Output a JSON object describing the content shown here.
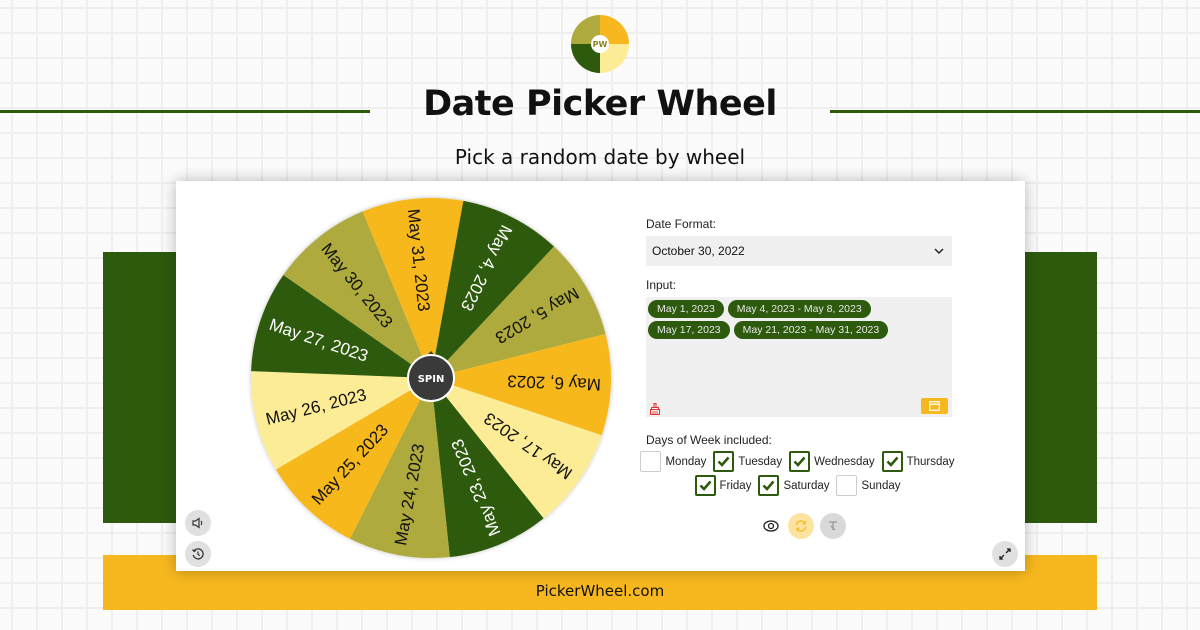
{
  "header": {
    "logo_text": "PW",
    "title": "Date Picker Wheel",
    "subtitle": "Pick a random date by wheel"
  },
  "colors": {
    "dark_green": "#2d5a0d",
    "olive": "#aeaa3e",
    "gold": "#f7b81f",
    "light_yellow": "#fdec96",
    "spin_button": "#3a3a3a",
    "clear_icon": "#e03030"
  },
  "wheel": {
    "spin_label": "SPIN",
    "slices": [
      {
        "label": "May 31, 2023",
        "color": "#f7b81f",
        "text_color": "#111111"
      },
      {
        "label": "May 4, 2023",
        "color": "#2d5a0d",
        "text_color": "#ffffff"
      },
      {
        "label": "May 5, 2023",
        "color": "#aeaa3e",
        "text_color": "#111111"
      },
      {
        "label": "May 6, 2023",
        "color": "#f7b81f",
        "text_color": "#111111"
      },
      {
        "label": "May 17, 2023",
        "color": "#fdec96",
        "text_color": "#111111"
      },
      {
        "label": "May 23, 2023",
        "color": "#2d5a0d",
        "text_color": "#ffffff"
      },
      {
        "label": "May 24, 2023",
        "color": "#aeaa3e",
        "text_color": "#111111"
      },
      {
        "label": "May 25, 2023",
        "color": "#f7b81f",
        "text_color": "#111111"
      },
      {
        "label": "May 26, 2023",
        "color": "#fdec96",
        "text_color": "#111111"
      },
      {
        "label": "May 27, 2023",
        "color": "#2d5a0d",
        "text_color": "#ffffff"
      },
      {
        "label": "May 30, 2023",
        "color": "#aeaa3e",
        "text_color": "#111111"
      }
    ]
  },
  "controls": {
    "sound_icon": "speaker-icon",
    "history_icon": "history-icon",
    "fullscreen_icon": "expand-icon"
  },
  "panel": {
    "date_format_label": "Date Format:",
    "date_format_value": "October 30, 2022",
    "input_label": "Input:",
    "chips": [
      "May 1, 2023",
      "May 4, 2023 - May 8, 2023",
      "May 17, 2023",
      "May 21, 2023 - May 31, 2023"
    ],
    "days_label": "Days of Week included:",
    "days": [
      {
        "name": "Monday",
        "checked": false
      },
      {
        "name": "Tuesday",
        "checked": true
      },
      {
        "name": "Wednesday",
        "checked": true
      },
      {
        "name": "Thursday",
        "checked": true
      },
      {
        "name": "Friday",
        "checked": true
      },
      {
        "name": "Saturday",
        "checked": true
      },
      {
        "name": "Sunday",
        "checked": false
      }
    ]
  },
  "footer": {
    "text": "PickerWheel.com"
  }
}
